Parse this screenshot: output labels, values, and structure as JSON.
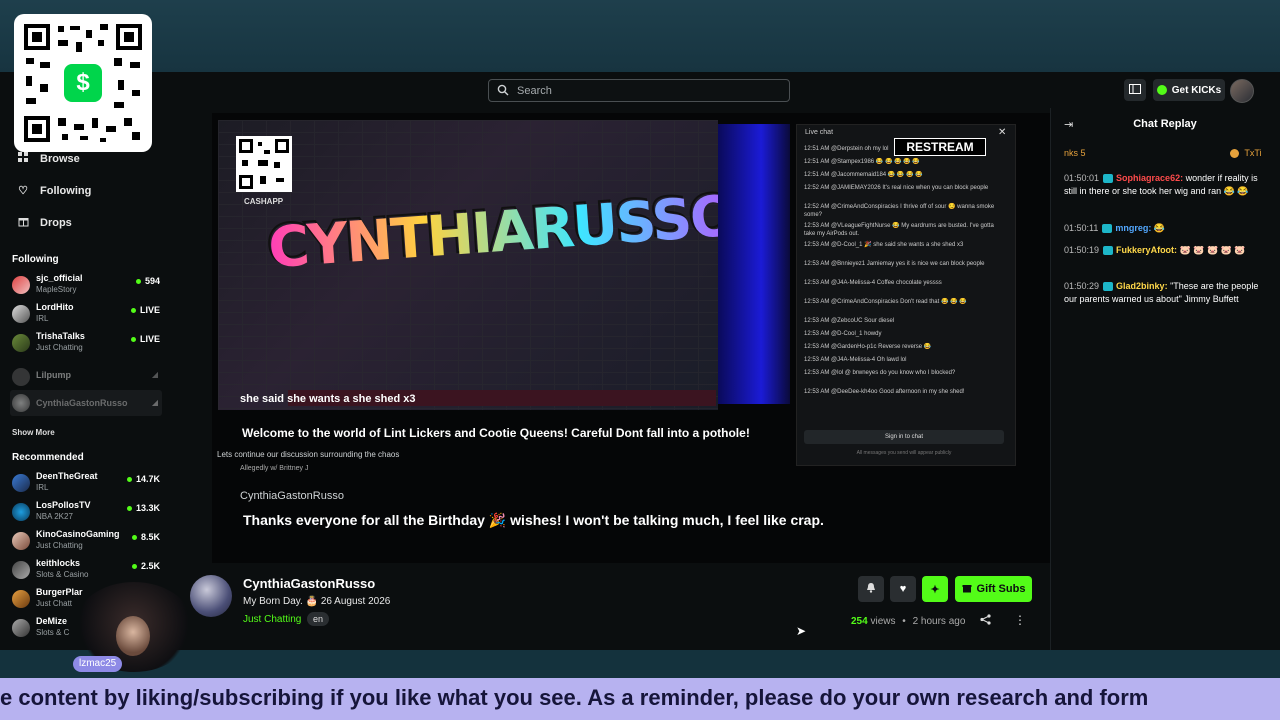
{
  "search": {
    "placeholder": "Search"
  },
  "topbar": {
    "get_kicks": "Get KICKs"
  },
  "sidebar": {
    "nav": [
      {
        "label": "Browse"
      },
      {
        "label": "Following"
      },
      {
        "label": "Drops"
      }
    ],
    "following_title": "Following",
    "following": [
      {
        "name": "sjc_official",
        "sub": "MapleStory",
        "status": "594"
      },
      {
        "name": "LordHito",
        "sub": "IRL",
        "status": "LIVE"
      },
      {
        "name": "TrishaTalks",
        "sub": "Just Chatting",
        "status": "LIVE"
      },
      {
        "name": "Lilpump",
        "sub": "",
        "status": ""
      },
      {
        "name": "CynthiaGastonRusso",
        "sub": "",
        "status": ""
      }
    ],
    "show_more": "Show More",
    "recommended_title": "Recommended",
    "recommended": [
      {
        "name": "DeenTheGreat",
        "sub": "IRL",
        "status": "14.7K"
      },
      {
        "name": "LosPollosTV",
        "sub": "NBA 2K27",
        "status": "13.3K"
      },
      {
        "name": "KinoCasinoGaming",
        "sub": "Just Chatting",
        "status": "8.5K"
      },
      {
        "name": "keithlocks",
        "sub": "Slots & Casino",
        "status": "2.5K"
      },
      {
        "name": "BurgerPlar",
        "sub": "Just Chatt",
        "status": ""
      },
      {
        "name": "DeMize",
        "sub": "Slots & C",
        "status": ""
      }
    ]
  },
  "overlay": {
    "cashapp_label": "CASHAPP",
    "graffiti": "CYNTHIARUSSO",
    "caption1": "she said she wants a she shed x3",
    "caption2": "Welcome to the world of Lint Lickers and Cootie Queens!  Careful Dont fall into a pothole!",
    "discussion": "Lets continue our discussion surrounding the chaos",
    "subline": "Allegedly w/ Brittney J",
    "streamer_name": "CynthiaGastonRusso",
    "birthday_msg": "Thanks everyone for all the Birthday 🎉 wishes! I won't be talking much, I feel like crap.",
    "cam_tag": "lzmac25"
  },
  "livechat": {
    "header": "Live chat",
    "restream": "RESTREAM",
    "signin": "Sign in to chat",
    "note": "All messages you send will appear publicly",
    "messages": [
      "12:51 AM  @Derpstein  oh my lol",
      "12:51 AM  @Stampex1986  😂 😂 😂 😂 😂",
      "12:51 AM  @Jacommemaid184  😂 😂 😂 😂",
      "12:52 AM  @JAMIEMAY2026  It's real nice when you can block people",
      "12:52 AM  @CrimeAndConspiracies  I thrive off of sour 😏 wanna smoke some?",
      "12:53 AM  @VLeagueFightNurse  😂  My eardrums are busted. I've gotta take my AirPods out.",
      "12:53 AM  @D-Cool_1  🎉  she said she wants a she shed x3",
      "12:53 AM  @Bnnieyez1  Jamiemay yes it is nice we can block people",
      "12:53 AM  @J4A-Melissa-4  Coffee chocolate yessss",
      "12:53 AM  @CrimeAndConspiracies  Don't read that 😂 😂 😂",
      "12:53 AM  @ZebcoUC  Sour diesel",
      "12:53 AM  @D-Cool_1  howdy",
      "12:53 AM  @GardenHo-p1c  Reverse reverse 😂",
      "12:53 AM  @J4A-Melissa-4  Oh lawd lol",
      "12:53 AM  @lol @ brwneyes do you know who I blocked?",
      "12:53 AM  @DeeDee-kh4oo  Good afternoon in my she shed!"
    ]
  },
  "info": {
    "name": "CynthiaGastonRusso",
    "title": "My Born Day. 🎂 26 August 2026",
    "category": "Just Chatting",
    "lang": "en",
    "gift_subs": "Gift Subs",
    "views_count": "254",
    "views_label": "views",
    "time": "2 hours ago"
  },
  "chat": {
    "title": "Chat Replay",
    "gift_left": "nks 5",
    "gift_right": "TxTi",
    "messages": [
      {
        "time": "01:50:01",
        "user": "Sophiagrace62:",
        "user_color": "#ff4b4b",
        "text": " wonder if reality is still in there or she took her wig and ran 😂 😂"
      },
      {
        "time": "01:50:11",
        "user": "mngreg:",
        "user_color": "#53a8ff",
        "text": " 😂"
      },
      {
        "time": "01:50:19",
        "user": "FukkeryAfoot:",
        "user_color": "#ffd84a",
        "text": " 🐷 🐷 🐷 🐷 🐷"
      },
      {
        "time": "01:50:29",
        "user": "Glad2binky:",
        "user_color": "#ffd84a",
        "text": " \"These are the people our parents warned us about\" Jimmy Buffett"
      }
    ]
  },
  "ticker": {
    "text": "e content by liking/subscribing if you like what you see. As a reminder, please do your own research and form"
  },
  "colors": {
    "accent": "#53fc18",
    "ticker_bg": "#b7b2f0",
    "band": "#1d3a46"
  }
}
